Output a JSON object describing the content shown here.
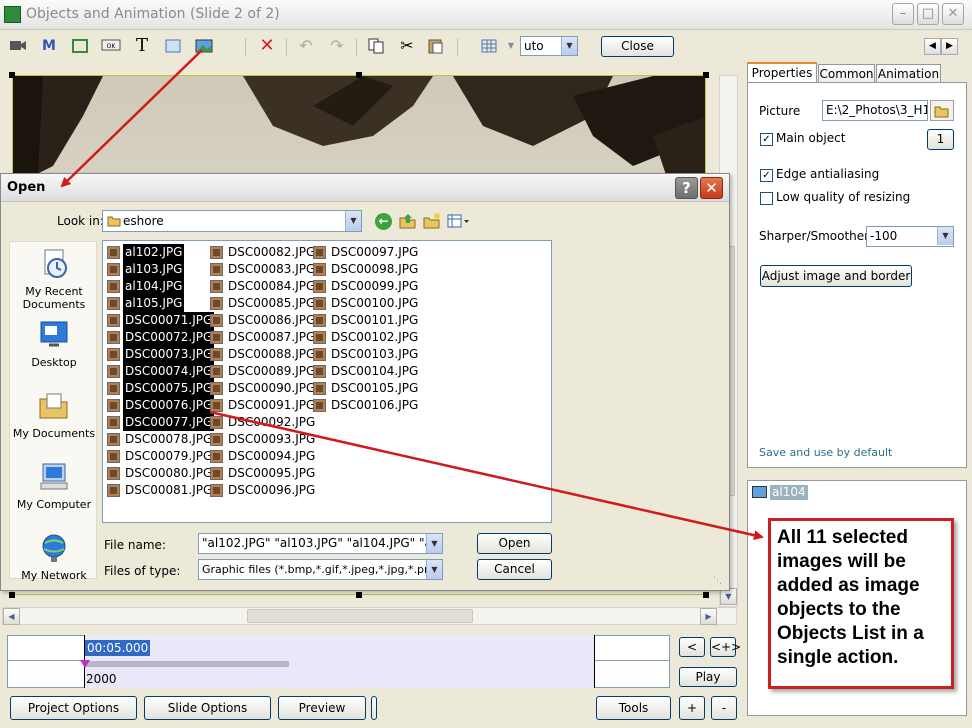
{
  "window": {
    "title": "Objects and Animation  (Slide 2 of 2)"
  },
  "toolbar": {
    "auto_value": "uto",
    "close_label": "Close"
  },
  "tabs": [
    {
      "label": "Properties"
    },
    {
      "label": "Common"
    },
    {
      "label": "Animation"
    }
  ],
  "properties": {
    "picture_label": "Picture",
    "picture_value": "E:\\2_Photos\\3_H1",
    "main_object_label": "Main object",
    "main_object_number": "1",
    "edge_antialiasing_label": "Edge antialiasing",
    "low_quality_label": "Low quality of resizing",
    "sharper_label": "Sharper/Smoother",
    "sharper_value": "-100",
    "adjust_label": "Adjust image and border",
    "save_default_label": "Save and use by default"
  },
  "objects_list": {
    "item": "al104"
  },
  "timeline": {
    "time": "00:05.000",
    "start": "2000",
    "btn_prev": "<",
    "btn_next": "<+>",
    "play": "Play"
  },
  "bottom": {
    "project_options": "Project Options",
    "slide_options": "Slide Options",
    "preview": "Preview",
    "tools": "Tools",
    "plus": "+",
    "minus": "-"
  },
  "dialog": {
    "title": "Open",
    "look_in_label": "Look in:",
    "look_in_value": "eshore",
    "places": [
      "My Recent Documents",
      "Desktop",
      "My Documents",
      "My Computer",
      "My Network"
    ],
    "files": [
      {
        "name": "al102.JPG",
        "selected": true
      },
      {
        "name": "al103.JPG",
        "selected": true
      },
      {
        "name": "al104.JPG",
        "selected": true
      },
      {
        "name": "al105.JPG",
        "selected": true
      },
      {
        "name": "DSC00071.JPG",
        "selected": true
      },
      {
        "name": "DSC00072.JPG",
        "selected": true
      },
      {
        "name": "DSC00073.JPG",
        "selected": true
      },
      {
        "name": "DSC00074.JPG",
        "selected": true
      },
      {
        "name": "DSC00075.JPG",
        "selected": true
      },
      {
        "name": "DSC00076.JPG",
        "selected": true
      },
      {
        "name": "DSC00077.JPG",
        "selected": true
      },
      {
        "name": "DSC00078.JPG",
        "selected": false
      },
      {
        "name": "DSC00079.JPG",
        "selected": false
      },
      {
        "name": "DSC00080.JPG",
        "selected": false
      },
      {
        "name": "DSC00081.JPG",
        "selected": false
      },
      {
        "name": "DSC00082.JPG",
        "selected": false
      },
      {
        "name": "DSC00083.JPG",
        "selected": false
      },
      {
        "name": "DSC00084.JPG",
        "selected": false
      },
      {
        "name": "DSC00085.JPG",
        "selected": false
      },
      {
        "name": "DSC00086.JPG",
        "selected": false
      },
      {
        "name": "DSC00087.JPG",
        "selected": false
      },
      {
        "name": "DSC00088.JPG",
        "selected": false
      },
      {
        "name": "DSC00089.JPG",
        "selected": false
      },
      {
        "name": "DSC00090.JPG",
        "selected": false
      },
      {
        "name": "DSC00091.JPG",
        "selected": false
      },
      {
        "name": "DSC00092.JPG",
        "selected": false
      },
      {
        "name": "DSC00093.JPG",
        "selected": false
      },
      {
        "name": "DSC00094.JPG",
        "selected": false
      },
      {
        "name": "DSC00095.JPG",
        "selected": false
      },
      {
        "name": "DSC00096.JPG",
        "selected": false
      },
      {
        "name": "DSC00097.JPG",
        "selected": false
      },
      {
        "name": "DSC00098.JPG",
        "selected": false
      },
      {
        "name": "DSC00099.JPG",
        "selected": false
      },
      {
        "name": "DSC00100.JPG",
        "selected": false
      },
      {
        "name": "DSC00101.JPG",
        "selected": false
      },
      {
        "name": "DSC00102.JPG",
        "selected": false
      },
      {
        "name": "DSC00103.JPG",
        "selected": false
      },
      {
        "name": "DSC00104.JPG",
        "selected": false
      },
      {
        "name": "DSC00105.JPG",
        "selected": false
      },
      {
        "name": "DSC00106.JPG",
        "selected": false
      }
    ],
    "file_name_label": "File name:",
    "file_name_value": "\"al102.JPG\" \"al103.JPG\" \"al104.JPG\" \"al105.",
    "file_type_label": "Files of type:",
    "file_type_value": "Graphic files (*.bmp,*.gif,*.jpeg,*.jpg,*.png)",
    "open_label": "Open",
    "cancel_label": "Cancel",
    "help_label": "?"
  },
  "callout": {
    "text": "All 11 selected images will be added as image objects to the Objects List in a single action."
  },
  "colors": {
    "selection": "#000000",
    "callout_border": "#cc1f1f",
    "tab_highlight": "#e68b2c",
    "link": "#2a6f8f",
    "timeline_time": "#316ac5"
  }
}
